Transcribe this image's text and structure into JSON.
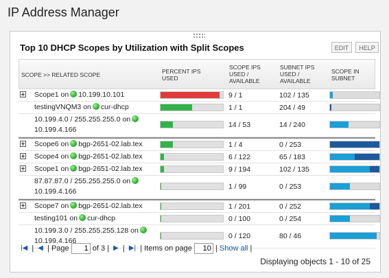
{
  "page_title": "IP Address Manager",
  "panel": {
    "title": "Top 10 DHCP Scopes by Utilization with Split Scopes",
    "edit_label": "EDIT",
    "help_label": "HELP"
  },
  "columns": {
    "scope": "SCOPE >> RELATED SCOPE",
    "percent_line1": "PERCENT IPS",
    "percent_line2": "USED",
    "scope_ips_line1": "SCOPE IPS",
    "scope_ips_line2": "USED /",
    "scope_ips_line3": "AVAILABLE",
    "subnet_ips_line1": "SUBNET IPS",
    "subnet_ips_line2": "USED /",
    "subnet_ips_line3": "AVAILABLE",
    "scope_in_subnet_line1": "SCOPE IN",
    "scope_in_subnet_line2": "SUBNET"
  },
  "rows": [
    {
      "expander": true,
      "prefix": "Scope1 on",
      "host": "10.199.10.101",
      "line2": "",
      "percent": 0.95,
      "bar_color": "#e03a3a",
      "scope_ips": "9 / 1",
      "subnet_ips": "102 / 135",
      "seg1": 0.06,
      "seg2": 0.0,
      "sep": false
    },
    {
      "expander": false,
      "prefix": "testingVNQM3 on",
      "host": "cur-dhcp",
      "line2": "",
      "percent": 0.5,
      "bar_color": "#33b24a",
      "scope_ips": "1 / 1",
      "subnet_ips": "204 / 49",
      "seg1": 0.0,
      "seg2": 0.03,
      "sep": false
    },
    {
      "expander": false,
      "prefix": "10.199.4.0 / 255.255.255.0 on",
      "host": "",
      "line2": "10.199.4.166",
      "percent": 0.2,
      "bar_color": "#33b24a",
      "scope_ips": "14 / 53",
      "subnet_ips": "14 / 240",
      "seg1": 0.38,
      "seg2": 0.0,
      "sep": false
    },
    {
      "expander": true,
      "prefix": "Scope6 on",
      "host": "bgp-2651-02.lab.tex",
      "line2": "",
      "percent": 0.2,
      "bar_color": "#33b24a",
      "scope_ips": "1 / 4",
      "subnet_ips": "0 / 253",
      "seg1": 0.0,
      "seg2": 1.0,
      "sep": true
    },
    {
      "expander": true,
      "prefix": "Scope4 on",
      "host": "bgp-2651-02.lab.tex",
      "line2": "",
      "percent": 0.05,
      "bar_color": "#33b24a",
      "scope_ips": "6 / 122",
      "subnet_ips": "65 / 183",
      "seg1": 0.5,
      "seg2": 0.5,
      "sep": false
    },
    {
      "expander": true,
      "prefix": "Scope1 on",
      "host": "bgp-2651-02.lab.tex",
      "line2": "",
      "percent": 0.05,
      "bar_color": "#33b24a",
      "scope_ips": "9 / 194",
      "subnet_ips": "102 / 135",
      "seg1": 0.8,
      "seg2": 0.2,
      "sep": false
    },
    {
      "expander": false,
      "prefix": "87.87.87.0 / 255.255.255.0 on",
      "host": "",
      "line2": "10.199.4.166",
      "percent": 0.01,
      "bar_color": "#33b24a",
      "scope_ips": "1 / 99",
      "subnet_ips": "0 / 253",
      "seg1": 0.4,
      "seg2": 0.0,
      "sep": false
    },
    {
      "expander": true,
      "prefix": "Scope7 on",
      "host": "bgp-2651-02.lab.tex",
      "line2": "",
      "percent": 0.01,
      "bar_color": "#33b24a",
      "scope_ips": "1 / 201",
      "subnet_ips": "0 / 252",
      "seg1": 0.8,
      "seg2": 0.2,
      "sep": true
    },
    {
      "expander": false,
      "prefix": "testing101 on",
      "host": "cur-dhcp",
      "line2": "",
      "percent": 0.0,
      "bar_color": "#33b24a",
      "scope_ips": "0 / 100",
      "subnet_ips": "0 / 254",
      "seg1": 0.4,
      "seg2": 0.0,
      "sep": false
    },
    {
      "expander": false,
      "prefix": "10.199.3.0 / 255.255.255.128 on",
      "host": "",
      "line2": "10.199.4.166",
      "percent": 0.0,
      "bar_color": "#33b24a",
      "scope_ips": "0 / 120",
      "subnet_ips": "80 / 46",
      "seg1": 0.95,
      "seg2": 0.0,
      "sep": false
    }
  ],
  "pager": {
    "page_label": "Page",
    "page_value": "1",
    "of_label": "of 3",
    "items_label": "Items on page",
    "items_value": "10",
    "show_all": "Show all",
    "divider": "|"
  },
  "status_text": "Displaying objects 1 - 10 of 25"
}
